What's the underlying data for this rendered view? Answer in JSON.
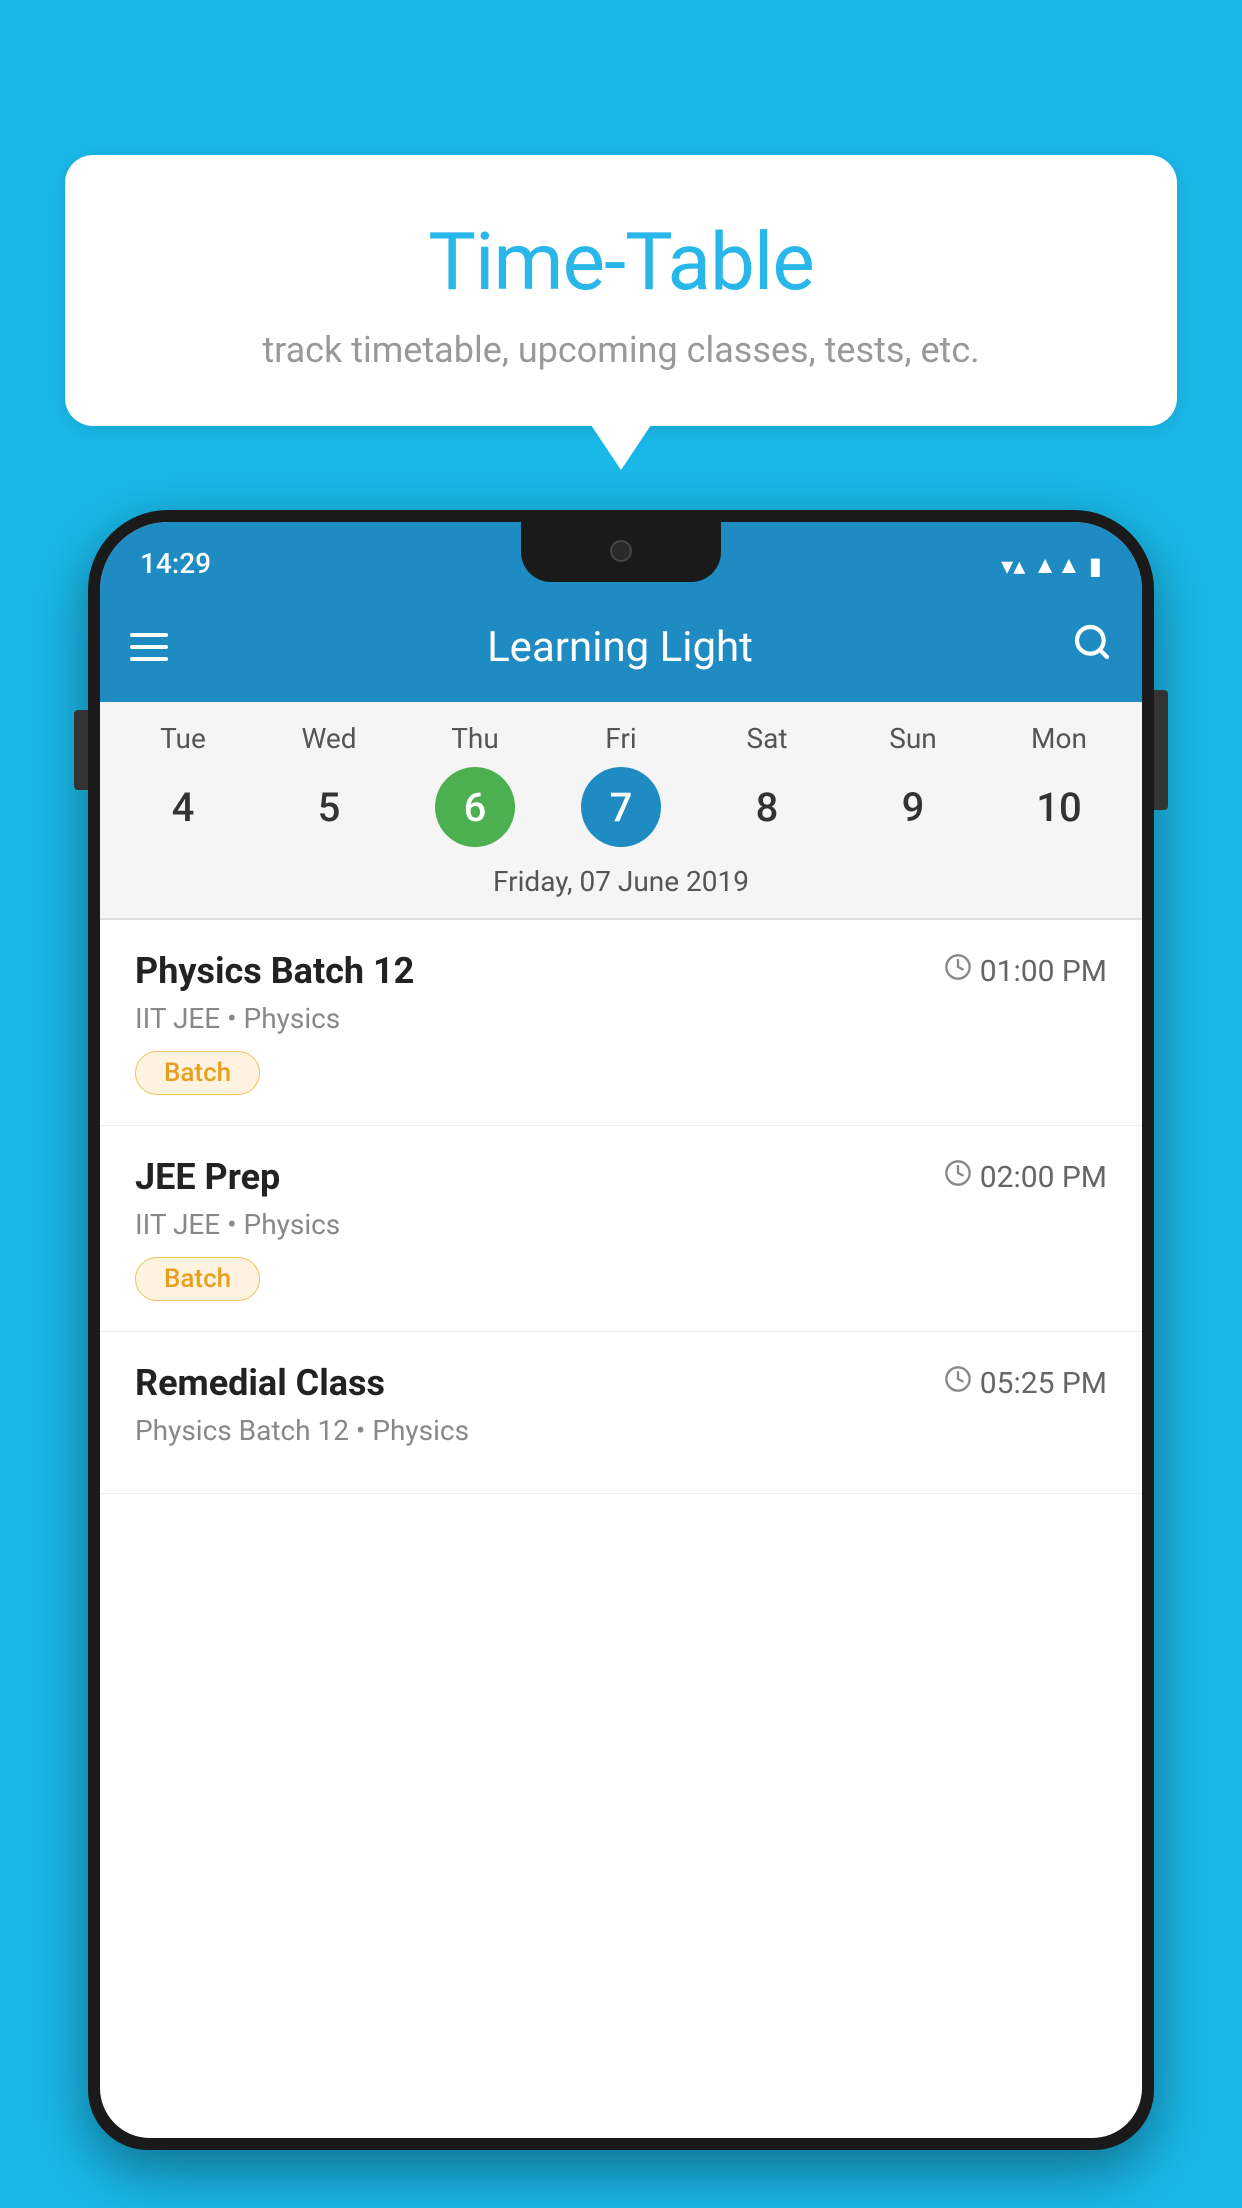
{
  "page": {
    "background_color": "#1ab8e8"
  },
  "speech_bubble": {
    "title": "Time-Table",
    "subtitle": "track timetable, upcoming classes, tests, etc."
  },
  "status_bar": {
    "time": "14:29"
  },
  "app_bar": {
    "title": "Learning Light"
  },
  "calendar": {
    "selected_date_label": "Friday, 07 June 2019",
    "days": [
      {
        "name": "Tue",
        "num": "4",
        "state": "normal"
      },
      {
        "name": "Wed",
        "num": "5",
        "state": "normal"
      },
      {
        "name": "Thu",
        "num": "6",
        "state": "today"
      },
      {
        "name": "Fri",
        "num": "7",
        "state": "selected"
      },
      {
        "name": "Sat",
        "num": "8",
        "state": "normal"
      },
      {
        "name": "Sun",
        "num": "9",
        "state": "normal"
      },
      {
        "name": "Mon",
        "num": "10",
        "state": "normal"
      }
    ]
  },
  "schedule": {
    "items": [
      {
        "title": "Physics Batch 12",
        "time": "01:00 PM",
        "sub": "IIT JEE • Physics",
        "tag": "Batch"
      },
      {
        "title": "JEE Prep",
        "time": "02:00 PM",
        "sub": "IIT JEE • Physics",
        "tag": "Batch"
      },
      {
        "title": "Remedial Class",
        "time": "05:25 PM",
        "sub": "Physics Batch 12 • Physics",
        "tag": ""
      }
    ]
  },
  "icons": {
    "hamburger": "☰",
    "search": "🔍",
    "clock": "🕐"
  }
}
